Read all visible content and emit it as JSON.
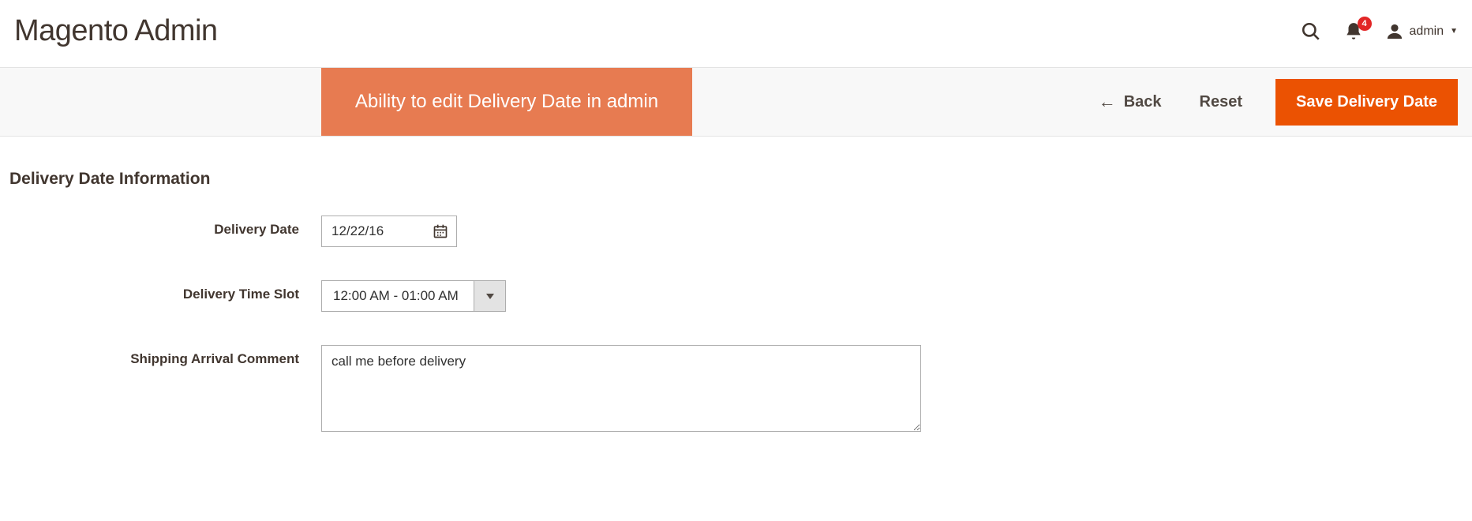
{
  "header": {
    "app_title": "Magento Admin",
    "notification_count": "4",
    "account_name": "admin"
  },
  "actionbar": {
    "banner_text": "Ability to edit Delivery Date in admin",
    "back_label": "Back",
    "reset_label": "Reset",
    "save_label": "Save Delivery Date"
  },
  "form": {
    "section_title": "Delivery Date Information",
    "delivery_date": {
      "label": "Delivery Date",
      "value": "12/22/16"
    },
    "delivery_time_slot": {
      "label": "Delivery Time Slot",
      "selected": "12:00 AM - 01:00 AM"
    },
    "shipping_comment": {
      "label": "Shipping Arrival Comment",
      "value": "call me before delivery"
    }
  },
  "icons": {
    "search": "search-icon",
    "bell": "bell-icon",
    "user": "user-icon",
    "calendar": "calendar-icon",
    "back_arrow": "arrow-left-icon",
    "chevron_down": "chevron-down-icon"
  },
  "colors": {
    "primary": "#eb5202",
    "banner": "#e77b51",
    "badge": "#e22626",
    "text": "#41362f"
  }
}
